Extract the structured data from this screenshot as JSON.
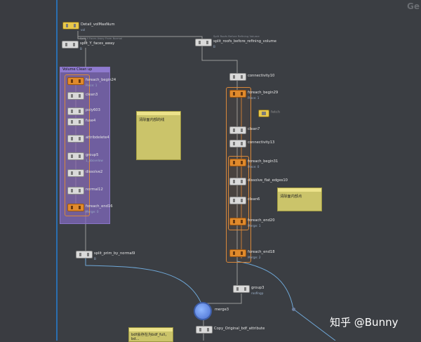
{
  "corner_label": "Ge",
  "watermark": "知乎 @Bunny",
  "network_box": {
    "title": "Volume Clean up"
  },
  "stickies": [
    {
      "text": "清除面内部的线"
    },
    {
      "text": "清除面内部点"
    },
    {
      "text": "bdf会存在为bdf_full，bd..."
    }
  ],
  "nodes": {
    "detail": {
      "label": "Detail_volMaxNum",
      "sub": "vol"
    },
    "split_y": {
      "label": "split_Y_faces_away",
      "sub": "B",
      "top": "Split Y-Faces Away From Normal"
    },
    "split_roofs": {
      "label": "split_roofs_before_refining_volume",
      "sub": "B",
      "top": "Split Roofs Before Refining Volume"
    },
    "foreach_begin24": {
      "label": "foreach_begin24",
      "sub": "Piece: 1"
    },
    "clean3": {
      "label": "clean3"
    },
    "poly603": {
      "label": "poly603"
    },
    "fuse4": {
      "label": "fuse4"
    },
    "attribdelete4": {
      "label": "attribdelete4"
    },
    "group5": {
      "label": "group5",
      "sub": "1_abovelow"
    },
    "dissolve2": {
      "label": "dissolve2"
    },
    "normal12": {
      "label": "normal12"
    },
    "foreach_end16": {
      "label": "foreach_end16",
      "sub": "Merge: 0"
    },
    "connectivity10": {
      "label": "connectivity10"
    },
    "foreach_begin29": {
      "label": "foreach_begin29",
      "sub": "Piece: 1"
    },
    "fetch": {
      "label": "fetch"
    },
    "clean7": {
      "label": "clean7"
    },
    "connectivity13": {
      "label": "connectivity13"
    },
    "foreach_begin31": {
      "label": "foreach_begin31",
      "sub": "Piece: 0"
    },
    "dissolve_flat_edges10": {
      "label": "dissolve_flat_edges10"
    },
    "clean6": {
      "label": "clean6"
    },
    "foreach_end20": {
      "label": "foreach_end20",
      "sub": "Merge: 1"
    },
    "foreach_end18": {
      "label": "foreach_end18",
      "sub": "Merge: 2"
    },
    "split_prim": {
      "label": "split_prim_by_normal9",
      "sub": "B"
    },
    "group3": {
      "label": "group3",
      "sub": "roofingp"
    },
    "merge3": {
      "label": "merge3"
    },
    "copy_original": {
      "label": "Copy_Original_bdf_attribute"
    }
  },
  "colors": {
    "background": "#3b3e43",
    "wire": "#9a9a9a",
    "wire_blue": "#6fa8d8",
    "node_default": "#d9d9d9",
    "node_foreach": "#e08a2c",
    "network_box": "#8a74c8",
    "sticky": "#cbc46a"
  }
}
